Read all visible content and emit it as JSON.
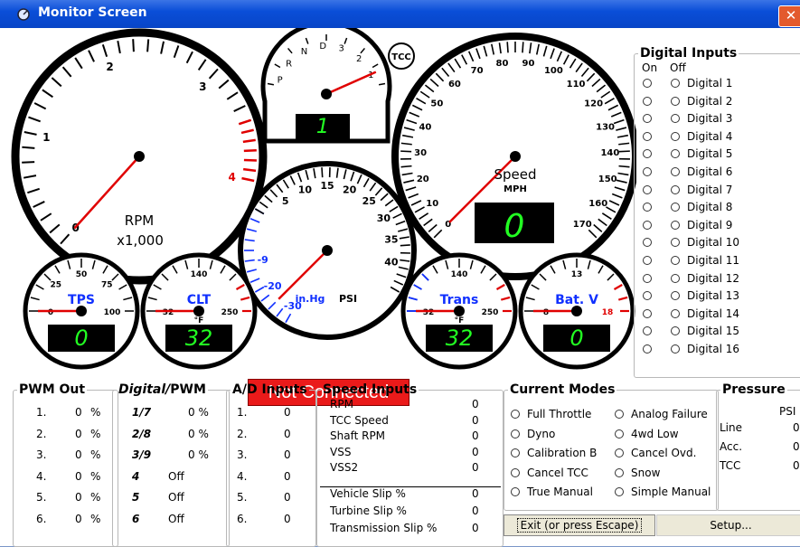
{
  "window": {
    "title": "Monitor Screen"
  },
  "tcc_badge": "TCC",
  "status": "Not Connected",
  "gauges": {
    "rpm": {
      "label": "RPM",
      "sublabel": "x1,000",
      "ticks": [
        "0",
        "1",
        "2",
        "3",
        "4"
      ],
      "value": 0
    },
    "gear": {
      "positions": [
        "P",
        "R",
        "N",
        "D",
        "3",
        "2",
        "1"
      ],
      "display": "1"
    },
    "speed": {
      "label": "Speed",
      "unit": "MPH",
      "ticks": [
        "0",
        "10",
        "20",
        "30",
        "40",
        "50",
        "60",
        "70",
        "80",
        "90",
        "100",
        "110",
        "120",
        "130",
        "140",
        "150",
        "160",
        "170"
      ],
      "display": "0"
    },
    "pressure": {
      "ticks_vac": [
        "-30",
        "-20",
        "-9"
      ],
      "ticks_psi": [
        "5",
        "10",
        "15",
        "20",
        "25",
        "30",
        "35",
        "40"
      ],
      "unit_vac": "in.Hg",
      "unit_psi": "PSI"
    },
    "tps": {
      "label": "TPS",
      "ticks": [
        "0",
        "25",
        "50",
        "75",
        "100"
      ],
      "display": "0"
    },
    "clt": {
      "label": "CLT",
      "ticks": [
        "32",
        "140",
        "250"
      ],
      "unit": "°F",
      "display": "32"
    },
    "trans": {
      "label": "Trans",
      "ticks": [
        "32",
        "140",
        "250"
      ],
      "unit": "°F",
      "display": "32"
    },
    "bat": {
      "label": "Bat. V",
      "ticks": [
        "8",
        "13",
        "18"
      ],
      "display": "0"
    }
  },
  "digital_inputs": {
    "title": "Digital Inputs",
    "on_label": "On",
    "off_label": "Off",
    "items": [
      "Digital 1",
      "Digital 2",
      "Digital 3",
      "Digital 4",
      "Digital 5",
      "Digital 6",
      "Digital 7",
      "Digital 8",
      "Digital 9",
      "Digital 10",
      "Digital 11",
      "Digital 12",
      "Digital 13",
      "Digital 14",
      "Digital 15",
      "Digital 16"
    ]
  },
  "pwm_out": {
    "title": "PWM Out",
    "rows": [
      {
        "n": "1.",
        "v": "0",
        "u": "%"
      },
      {
        "n": "2.",
        "v": "0",
        "u": "%"
      },
      {
        "n": "3.",
        "v": "0",
        "u": "%"
      },
      {
        "n": "4.",
        "v": "0",
        "u": "%"
      },
      {
        "n": "5.",
        "v": "0",
        "u": "%"
      },
      {
        "n": "6.",
        "v": "0",
        "u": "%"
      }
    ]
  },
  "digital_pwm": {
    "title_a": "Digital/",
    "title_b": "PWM",
    "rows": [
      {
        "n": "1/7",
        "v": "0 %"
      },
      {
        "n": "2/8",
        "v": "0 %"
      },
      {
        "n": "3/9",
        "v": "0 %"
      },
      {
        "n": "4",
        "v": "Off"
      },
      {
        "n": "5",
        "v": "Off"
      },
      {
        "n": "6",
        "v": "Off"
      }
    ]
  },
  "ad_inputs": {
    "title": "A/D Inputs",
    "rows": [
      {
        "n": "1.",
        "v": "0"
      },
      {
        "n": "2.",
        "v": "0"
      },
      {
        "n": "3.",
        "v": "0"
      },
      {
        "n": "4.",
        "v": "0"
      },
      {
        "n": "5.",
        "v": "0"
      },
      {
        "n": "6.",
        "v": "0"
      }
    ]
  },
  "speed_inputs": {
    "title": "Speed Inputs",
    "rows": [
      {
        "label": "RPM",
        "v": "0"
      },
      {
        "label": "TCC Speed",
        "v": "0"
      },
      {
        "label": "Shaft RPM",
        "v": "0"
      },
      {
        "label": "VSS",
        "v": "0"
      },
      {
        "label": "VSS2",
        "v": "0"
      }
    ],
    "slip_rows": [
      {
        "label": "Vehicle Slip %",
        "v": "0"
      },
      {
        "label": "Turbine Slip %",
        "v": "0"
      },
      {
        "label": "Transmission Slip %",
        "v": "0"
      }
    ]
  },
  "current_modes": {
    "title": "Current Modes",
    "left": [
      "Full Throttle",
      "Dyno",
      "Calibration B",
      "Cancel TCC",
      "True Manual"
    ],
    "right": [
      "Analog Failure",
      "4wd Low",
      "Cancel Ovd.",
      "Snow",
      "Simple Manual"
    ]
  },
  "pressure_panel": {
    "title": "Pressure",
    "unit": "PSI",
    "rows": [
      {
        "label": "Line",
        "v": "0"
      },
      {
        "label": "Acc.",
        "v": "0"
      },
      {
        "label": "TCC",
        "v": "0"
      }
    ]
  },
  "buttons": {
    "exit": "Exit (or press Escape)",
    "setup": "Setup..."
  }
}
